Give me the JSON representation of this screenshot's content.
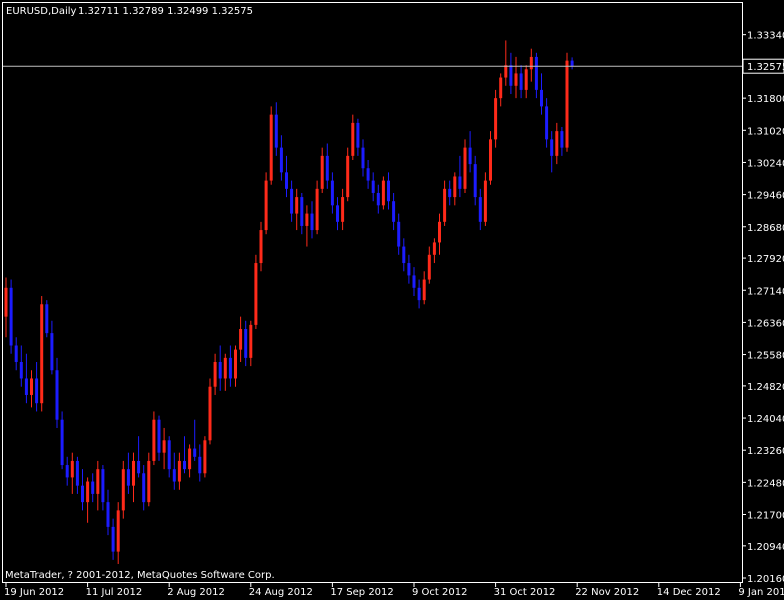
{
  "header": {
    "symbol": "EURUSD,Daily",
    "ohlc": "1.32711 1.32789 1.32499 1.32575"
  },
  "footer": {
    "copyright": "MetaTrader, ? 2001-2012, MetaQuotes Software Corp."
  },
  "colors": {
    "background": "#000000",
    "axis": "#ffffff",
    "bull": "#ff2a1a",
    "bear": "#1c1cff",
    "price_line": "#c0c0c0",
    "price_label_bg": "#000000",
    "price_label_text": "#ffffff"
  },
  "chart_data": {
    "type": "candlestick",
    "symbol": "EURUSD",
    "timeframe": "Daily",
    "current_price": 1.32575,
    "current_price_label": "1.32575",
    "ylim": [
      1.2016,
      1.3372
    ],
    "y_ticks": [
      {
        "label": "1.33340",
        "value": 1.3334
      },
      {
        "label": "1.31800",
        "value": 1.318
      },
      {
        "label": "1.31020",
        "value": 1.3102
      },
      {
        "label": "1.30240",
        "value": 1.3024
      },
      {
        "label": "1.29460",
        "value": 1.2946
      },
      {
        "label": "1.28680",
        "value": 1.2868
      },
      {
        "label": "1.27920",
        "value": 1.2792
      },
      {
        "label": "1.27140",
        "value": 1.2714
      },
      {
        "label": "1.26360",
        "value": 1.2636
      },
      {
        "label": "1.25580",
        "value": 1.2558
      },
      {
        "label": "1.24820",
        "value": 1.2482
      },
      {
        "label": "1.24040",
        "value": 1.2404
      },
      {
        "label": "1.23260",
        "value": 1.2326
      },
      {
        "label": "1.22480",
        "value": 1.2248
      },
      {
        "label": "1.21700",
        "value": 1.217
      },
      {
        "label": "1.20940",
        "value": 1.2094
      },
      {
        "label": "1.20160",
        "value": 1.2016
      }
    ],
    "x_ticks": [
      {
        "label": "19 Jun 2012",
        "bar": 0
      },
      {
        "label": "11 Jul 2012",
        "bar": 16
      },
      {
        "label": "2 Aug 2012",
        "bar": 32
      },
      {
        "label": "24 Aug 2012",
        "bar": 48
      },
      {
        "label": "17 Sep 2012",
        "bar": 64
      },
      {
        "label": "9 Oct 2012",
        "bar": 80
      },
      {
        "label": "31 Oct 2012",
        "bar": 96
      },
      {
        "label": "22 Nov 2012",
        "bar": 112
      },
      {
        "label": "14 Dec 2012",
        "bar": 128
      },
      {
        "label": "9 Jan 2013",
        "bar": 144
      }
    ],
    "candles": [
      {
        "o": 1.265,
        "h": 1.2745,
        "l": 1.26,
        "c": 1.272
      },
      {
        "o": 1.272,
        "h": 1.274,
        "l": 1.256,
        "c": 1.258
      },
      {
        "o": 1.258,
        "h": 1.26,
        "l": 1.252,
        "c": 1.254
      },
      {
        "o": 1.254,
        "h": 1.258,
        "l": 1.248,
        "c": 1.25
      },
      {
        "o": 1.25,
        "h": 1.256,
        "l": 1.244,
        "c": 1.246
      },
      {
        "o": 1.246,
        "h": 1.252,
        "l": 1.243,
        "c": 1.25
      },
      {
        "o": 1.25,
        "h": 1.254,
        "l": 1.242,
        "c": 1.244
      },
      {
        "o": 1.244,
        "h": 1.27,
        "l": 1.242,
        "c": 1.268
      },
      {
        "o": 1.268,
        "h": 1.269,
        "l": 1.26,
        "c": 1.261
      },
      {
        "o": 1.261,
        "h": 1.264,
        "l": 1.251,
        "c": 1.252
      },
      {
        "o": 1.252,
        "h": 1.255,
        "l": 1.238,
        "c": 1.24
      },
      {
        "o": 1.24,
        "h": 1.242,
        "l": 1.228,
        "c": 1.229
      },
      {
        "o": 1.229,
        "h": 1.231,
        "l": 1.224,
        "c": 1.226
      },
      {
        "o": 1.226,
        "h": 1.232,
        "l": 1.222,
        "c": 1.23
      },
      {
        "o": 1.23,
        "h": 1.231,
        "l": 1.222,
        "c": 1.224
      },
      {
        "o": 1.224,
        "h": 1.228,
        "l": 1.218,
        "c": 1.22
      },
      {
        "o": 1.22,
        "h": 1.226,
        "l": 1.215,
        "c": 1.225
      },
      {
        "o": 1.225,
        "h": 1.227,
        "l": 1.22,
        "c": 1.222
      },
      {
        "o": 1.222,
        "h": 1.23,
        "l": 1.218,
        "c": 1.228
      },
      {
        "o": 1.228,
        "h": 1.229,
        "l": 1.218,
        "c": 1.22
      },
      {
        "o": 1.22,
        "h": 1.223,
        "l": 1.212,
        "c": 1.214
      },
      {
        "o": 1.214,
        "h": 1.216,
        "l": 1.206,
        "c": 1.208
      },
      {
        "o": 1.208,
        "h": 1.22,
        "l": 1.205,
        "c": 1.218
      },
      {
        "o": 1.218,
        "h": 1.23,
        "l": 1.216,
        "c": 1.228
      },
      {
        "o": 1.228,
        "h": 1.232,
        "l": 1.222,
        "c": 1.224
      },
      {
        "o": 1.224,
        "h": 1.232,
        "l": 1.22,
        "c": 1.23
      },
      {
        "o": 1.23,
        "h": 1.236,
        "l": 1.226,
        "c": 1.227
      },
      {
        "o": 1.227,
        "h": 1.229,
        "l": 1.218,
        "c": 1.22
      },
      {
        "o": 1.22,
        "h": 1.232,
        "l": 1.219,
        "c": 1.23
      },
      {
        "o": 1.23,
        "h": 1.242,
        "l": 1.229,
        "c": 1.24
      },
      {
        "o": 1.24,
        "h": 1.241,
        "l": 1.23,
        "c": 1.232
      },
      {
        "o": 1.232,
        "h": 1.238,
        "l": 1.228,
        "c": 1.235
      },
      {
        "o": 1.235,
        "h": 1.236,
        "l": 1.226,
        "c": 1.228
      },
      {
        "o": 1.228,
        "h": 1.232,
        "l": 1.223,
        "c": 1.225
      },
      {
        "o": 1.225,
        "h": 1.232,
        "l": 1.223,
        "c": 1.23
      },
      {
        "o": 1.23,
        "h": 1.236,
        "l": 1.227,
        "c": 1.228
      },
      {
        "o": 1.228,
        "h": 1.234,
        "l": 1.226,
        "c": 1.233
      },
      {
        "o": 1.233,
        "h": 1.24,
        "l": 1.23,
        "c": 1.231
      },
      {
        "o": 1.231,
        "h": 1.234,
        "l": 1.225,
        "c": 1.227
      },
      {
        "o": 1.227,
        "h": 1.236,
        "l": 1.226,
        "c": 1.235
      },
      {
        "o": 1.235,
        "h": 1.25,
        "l": 1.234,
        "c": 1.248
      },
      {
        "o": 1.248,
        "h": 1.256,
        "l": 1.246,
        "c": 1.254
      },
      {
        "o": 1.254,
        "h": 1.258,
        "l": 1.247,
        "c": 1.25
      },
      {
        "o": 1.25,
        "h": 1.256,
        "l": 1.247,
        "c": 1.255
      },
      {
        "o": 1.255,
        "h": 1.258,
        "l": 1.248,
        "c": 1.25
      },
      {
        "o": 1.25,
        "h": 1.258,
        "l": 1.248,
        "c": 1.257
      },
      {
        "o": 1.257,
        "h": 1.265,
        "l": 1.254,
        "c": 1.262
      },
      {
        "o": 1.262,
        "h": 1.264,
        "l": 1.253,
        "c": 1.255
      },
      {
        "o": 1.255,
        "h": 1.264,
        "l": 1.253,
        "c": 1.263
      },
      {
        "o": 1.263,
        "h": 1.28,
        "l": 1.262,
        "c": 1.278
      },
      {
        "o": 1.278,
        "h": 1.288,
        "l": 1.276,
        "c": 1.286
      },
      {
        "o": 1.286,
        "h": 1.3,
        "l": 1.285,
        "c": 1.298
      },
      {
        "o": 1.298,
        "h": 1.316,
        "l": 1.297,
        "c": 1.314
      },
      {
        "o": 1.314,
        "h": 1.317,
        "l": 1.304,
        "c": 1.306
      },
      {
        "o": 1.306,
        "h": 1.309,
        "l": 1.298,
        "c": 1.3
      },
      {
        "o": 1.3,
        "h": 1.304,
        "l": 1.294,
        "c": 1.296
      },
      {
        "o": 1.296,
        "h": 1.298,
        "l": 1.288,
        "c": 1.29
      },
      {
        "o": 1.29,
        "h": 1.296,
        "l": 1.286,
        "c": 1.294
      },
      {
        "o": 1.294,
        "h": 1.295,
        "l": 1.285,
        "c": 1.287
      },
      {
        "o": 1.287,
        "h": 1.292,
        "l": 1.282,
        "c": 1.29
      },
      {
        "o": 1.29,
        "h": 1.293,
        "l": 1.284,
        "c": 1.286
      },
      {
        "o": 1.286,
        "h": 1.298,
        "l": 1.285,
        "c": 1.296
      },
      {
        "o": 1.296,
        "h": 1.306,
        "l": 1.295,
        "c": 1.304
      },
      {
        "o": 1.304,
        "h": 1.307,
        "l": 1.296,
        "c": 1.298
      },
      {
        "o": 1.298,
        "h": 1.3,
        "l": 1.29,
        "c": 1.292
      },
      {
        "o": 1.292,
        "h": 1.294,
        "l": 1.286,
        "c": 1.288
      },
      {
        "o": 1.288,
        "h": 1.296,
        "l": 1.286,
        "c": 1.294
      },
      {
        "o": 1.294,
        "h": 1.306,
        "l": 1.293,
        "c": 1.304
      },
      {
        "o": 1.304,
        "h": 1.314,
        "l": 1.303,
        "c": 1.312
      },
      {
        "o": 1.312,
        "h": 1.313,
        "l": 1.304,
        "c": 1.306
      },
      {
        "o": 1.306,
        "h": 1.308,
        "l": 1.299,
        "c": 1.301
      },
      {
        "o": 1.301,
        "h": 1.303,
        "l": 1.296,
        "c": 1.298
      },
      {
        "o": 1.298,
        "h": 1.3,
        "l": 1.293,
        "c": 1.295
      },
      {
        "o": 1.295,
        "h": 1.297,
        "l": 1.29,
        "c": 1.292
      },
      {
        "o": 1.292,
        "h": 1.299,
        "l": 1.291,
        "c": 1.298
      },
      {
        "o": 1.298,
        "h": 1.3,
        "l": 1.291,
        "c": 1.293
      },
      {
        "o": 1.293,
        "h": 1.295,
        "l": 1.286,
        "c": 1.288
      },
      {
        "o": 1.288,
        "h": 1.29,
        "l": 1.28,
        "c": 1.282
      },
      {
        "o": 1.282,
        "h": 1.284,
        "l": 1.276,
        "c": 1.278
      },
      {
        "o": 1.278,
        "h": 1.28,
        "l": 1.273,
        "c": 1.275
      },
      {
        "o": 1.275,
        "h": 1.277,
        "l": 1.27,
        "c": 1.272
      },
      {
        "o": 1.272,
        "h": 1.274,
        "l": 1.267,
        "c": 1.269
      },
      {
        "o": 1.269,
        "h": 1.276,
        "l": 1.268,
        "c": 1.274
      },
      {
        "o": 1.274,
        "h": 1.282,
        "l": 1.273,
        "c": 1.28
      },
      {
        "o": 1.28,
        "h": 1.284,
        "l": 1.278,
        "c": 1.283
      },
      {
        "o": 1.283,
        "h": 1.29,
        "l": 1.28,
        "c": 1.288
      },
      {
        "o": 1.288,
        "h": 1.298,
        "l": 1.287,
        "c": 1.296
      },
      {
        "o": 1.296,
        "h": 1.298,
        "l": 1.292,
        "c": 1.294
      },
      {
        "o": 1.294,
        "h": 1.3,
        "l": 1.292,
        "c": 1.299
      },
      {
        "o": 1.299,
        "h": 1.304,
        "l": 1.294,
        "c": 1.296
      },
      {
        "o": 1.296,
        "h": 1.308,
        "l": 1.295,
        "c": 1.306
      },
      {
        "o": 1.306,
        "h": 1.31,
        "l": 1.3,
        "c": 1.302
      },
      {
        "o": 1.302,
        "h": 1.304,
        "l": 1.292,
        "c": 1.294
      },
      {
        "o": 1.294,
        "h": 1.296,
        "l": 1.286,
        "c": 1.288
      },
      {
        "o": 1.288,
        "h": 1.3,
        "l": 1.287,
        "c": 1.298
      },
      {
        "o": 1.298,
        "h": 1.31,
        "l": 1.297,
        "c": 1.308
      },
      {
        "o": 1.308,
        "h": 1.32,
        "l": 1.306,
        "c": 1.318
      },
      {
        "o": 1.318,
        "h": 1.324,
        "l": 1.316,
        "c": 1.323
      },
      {
        "o": 1.323,
        "h": 1.332,
        "l": 1.321,
        "c": 1.326
      },
      {
        "o": 1.326,
        "h": 1.329,
        "l": 1.319,
        "c": 1.321
      },
      {
        "o": 1.321,
        "h": 1.328,
        "l": 1.318,
        "c": 1.324
      },
      {
        "o": 1.324,
        "h": 1.326,
        "l": 1.318,
        "c": 1.32
      },
      {
        "o": 1.32,
        "h": 1.326,
        "l": 1.318,
        "c": 1.325
      },
      {
        "o": 1.325,
        "h": 1.33,
        "l": 1.322,
        "c": 1.328
      },
      {
        "o": 1.328,
        "h": 1.329,
        "l": 1.318,
        "c": 1.32
      },
      {
        "o": 1.32,
        "h": 1.324,
        "l": 1.314,
        "c": 1.316
      },
      {
        "o": 1.316,
        "h": 1.318,
        "l": 1.306,
        "c": 1.308
      },
      {
        "o": 1.308,
        "h": 1.31,
        "l": 1.3,
        "c": 1.304
      },
      {
        "o": 1.304,
        "h": 1.312,
        "l": 1.302,
        "c": 1.31
      },
      {
        "o": 1.31,
        "h": 1.311,
        "l": 1.304,
        "c": 1.306
      },
      {
        "o": 1.306,
        "h": 1.329,
        "l": 1.305,
        "c": 1.3271
      },
      {
        "o": 1.32711,
        "h": 1.32789,
        "l": 1.32499,
        "c": 1.32575
      }
    ]
  }
}
